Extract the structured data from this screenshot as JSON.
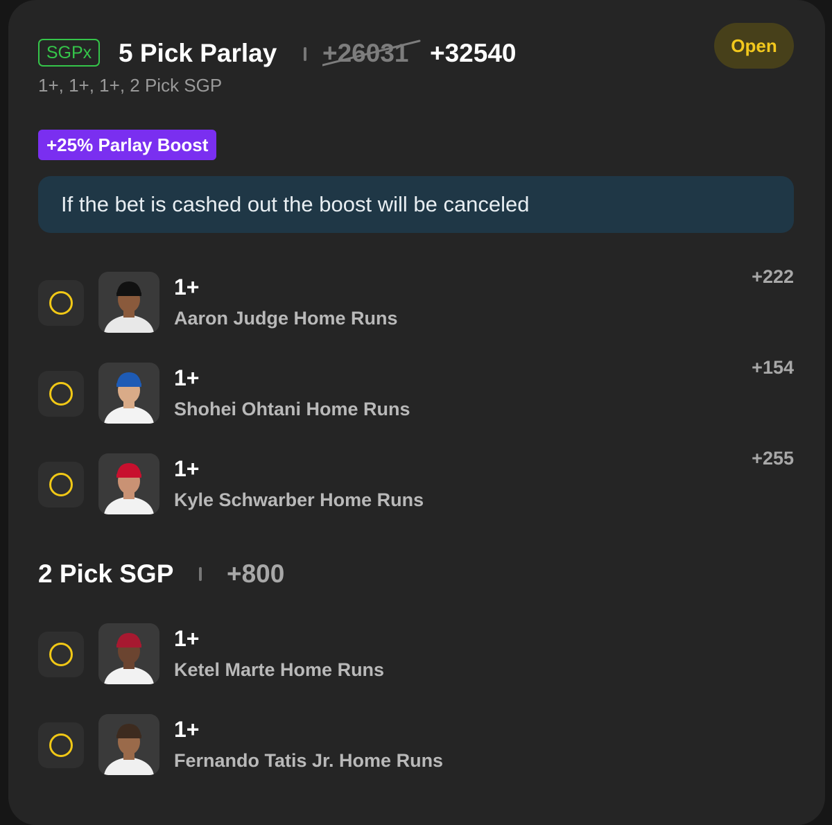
{
  "bet": {
    "tag": "SGPx",
    "title": "5 Pick Parlay",
    "original_odds": "+26031",
    "boosted_odds": "+32540",
    "subtitle": "1+, 1+, 1+, 2 Pick SGP",
    "status": "Open"
  },
  "boost": {
    "label": "+25% Parlay Boost",
    "notice": "If the bet is cashed out the boost will be canceled"
  },
  "legs": [
    {
      "line": "1+",
      "market": "Aaron Judge Home Runs",
      "odds": "+222",
      "avatar_icon": "player-avatar-aaron-judge",
      "cap_color": "#111111",
      "jersey_color": "#e8e8e8"
    },
    {
      "line": "1+",
      "market": "Shohei Ohtani Home Runs",
      "odds": "+154",
      "avatar_icon": "player-avatar-shohei-ohtani",
      "cap_color": "#1e5bb5",
      "jersey_color": "#f3f3f3"
    },
    {
      "line": "1+",
      "market": "Kyle Schwarber Home Runs",
      "odds": "+255",
      "avatar_icon": "player-avatar-kyle-schwarber",
      "cap_color": "#c8102e",
      "jersey_color": "#f2f2f2"
    }
  ],
  "sgp_group": {
    "title": "2 Pick SGP",
    "odds": "+800",
    "legs": [
      {
        "line": "1+",
        "market": "Ketel Marte Home Runs",
        "avatar_icon": "player-avatar-ketel-marte",
        "cap_color": "#a71930",
        "jersey_color": "#f2f2f2"
      },
      {
        "line": "1+",
        "market": "Fernando Tatis Jr. Home Runs",
        "avatar_icon": "player-avatar-fernando-tatis-jr",
        "cap_color": "#3d2b1f",
        "jersey_color": "#f0f0f0"
      }
    ]
  },
  "colors": {
    "accent_green": "#35c54a",
    "status_yellow": "#f2c81d",
    "boost_purple": "#7a2ff0",
    "notice_bg": "#1f3746",
    "radio_ring": "#f1c816"
  }
}
